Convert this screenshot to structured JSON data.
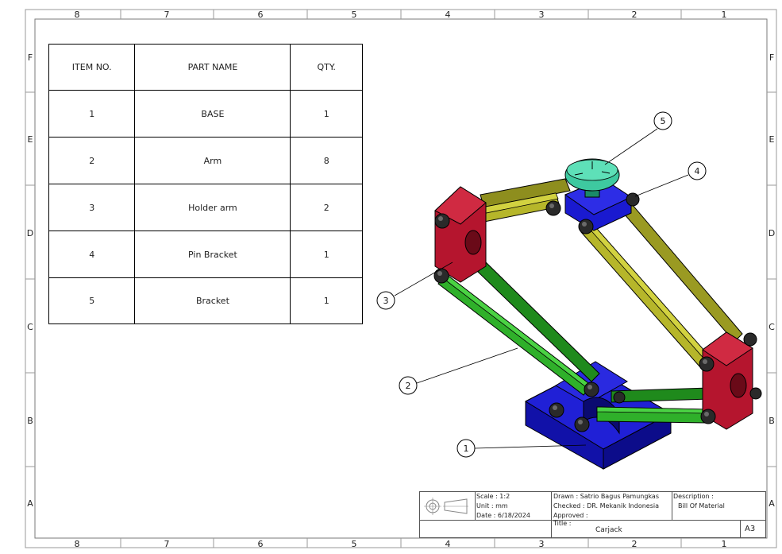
{
  "zones": {
    "columns": [
      "8",
      "7",
      "6",
      "5",
      "4",
      "3",
      "2",
      "1"
    ],
    "rows": [
      "F",
      "E",
      "D",
      "C",
      "B",
      "A"
    ]
  },
  "bom": {
    "headers": {
      "item": "ITEM NO.",
      "part": "PART NAME",
      "qty": "QTY."
    },
    "rows": [
      {
        "item": "1",
        "part": "BASE",
        "qty": "1"
      },
      {
        "item": "2",
        "part": "Arm",
        "qty": "8"
      },
      {
        "item": "3",
        "part": "Holder arm",
        "qty": "2"
      },
      {
        "item": "4",
        "part": "Pin Bracket",
        "qty": "1"
      },
      {
        "item": "5",
        "part": "Bracket",
        "qty": "1"
      }
    ]
  },
  "balloons": [
    "1",
    "2",
    "3",
    "4",
    "5"
  ],
  "title_block": {
    "scale": "Scale : 1:2",
    "unit": "Unit    : mm",
    "date": "Date  : 6/18/2024",
    "drawn": "Drawn      : Satrio Bagus Pamungkas",
    "checked": "Checked  : DR. Mekanik Indonesia",
    "approved": "Approved :",
    "title_label": "Title :",
    "title": "Carjack",
    "description_label": "Description :",
    "description": "Bill Of Material",
    "size": "A3"
  },
  "colors": {
    "base": "#1a1ad0",
    "arm_green": "#2fb02a",
    "arm_yellow": "#b6b62a",
    "holder": "#b5152e",
    "bracket": "#3ec9a0",
    "bolt": "#2a2a2a"
  }
}
